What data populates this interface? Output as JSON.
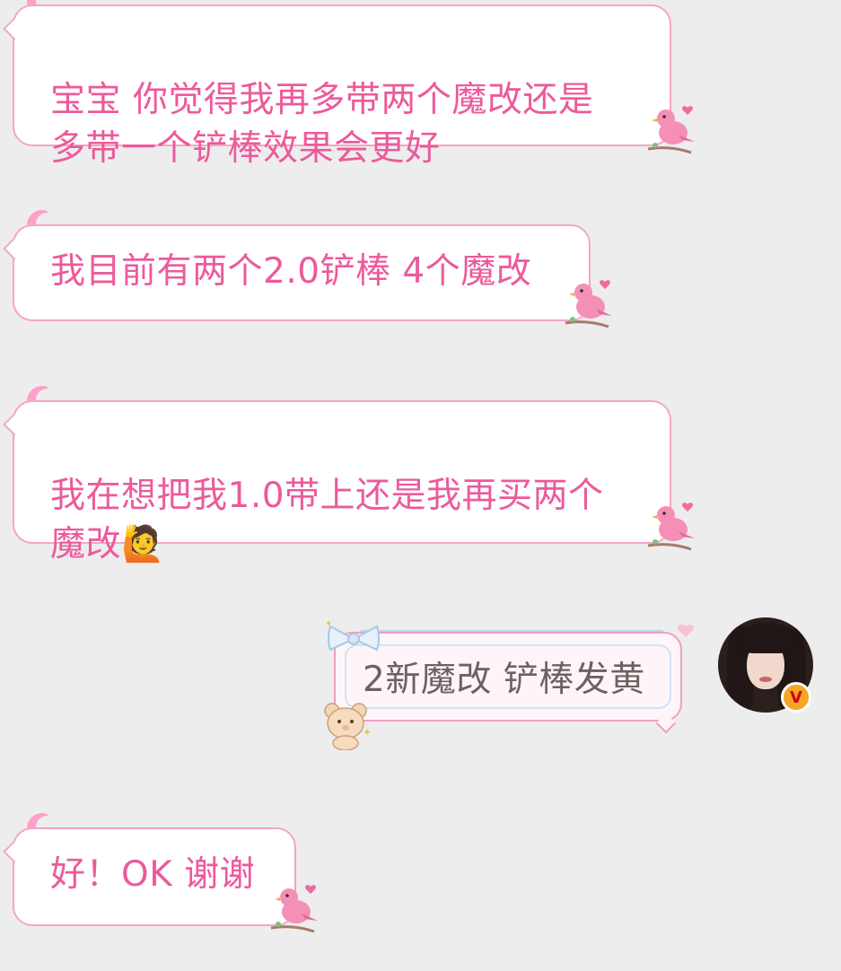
{
  "messages": [
    {
      "text": "宝宝 你觉得我再多带两个魔改还是\n多带一个铲棒效果会更好"
    },
    {
      "text": "我目前有两个2.0铲棒 4个魔改"
    },
    {
      "text": "我在想把我1.0带上还是我再买两个\n魔改🙋"
    },
    {
      "text": "2新魔改 铲棒发黄"
    },
    {
      "text": "好！OK 谢谢"
    }
  ],
  "avatar": {
    "badge": "V"
  },
  "colors": {
    "background": "#ededed",
    "incoming_text": "#ec5a9b",
    "incoming_border": "#f3a6c6",
    "outgoing_text": "#6b6262",
    "outgoing_border": "#ef9fbf",
    "badge": "#f5a623"
  },
  "icons": {
    "bubble_top_left": "moon-icon",
    "bubble_bottom_right": "bird-icon",
    "outgoing_decoration": [
      "bow-icon",
      "bear-icon"
    ],
    "badge": "verified-v-icon"
  }
}
